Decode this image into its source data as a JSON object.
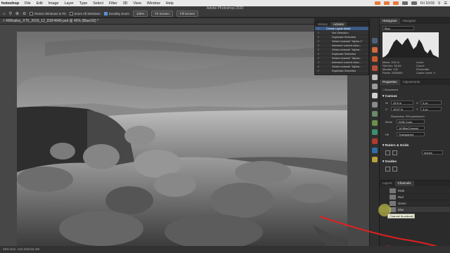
{
  "menubar": {
    "app": "hotoshop",
    "items": [
      "File",
      "Edit",
      "Image",
      "Layer",
      "Type",
      "Select",
      "Filter",
      "3D",
      "View",
      "Window",
      "Help"
    ],
    "clock": "Fri 10:03"
  },
  "window": {
    "title": "Adobe Photoshop 2020"
  },
  "options": {
    "resize_windows": "Resize Windows to Fit",
    "zoom_all": "Zoom All Windows",
    "scrubby_zoom": "Scrubby Zoom",
    "zoom_level": "100%",
    "fit_screen": "Fit Screen",
    "fill_screen": "Fill Screen"
  },
  "document": {
    "tab_title": "RWhalley_XT5_2019_12_DSF4949.psd @ 45% (Blue/16) *"
  },
  "status": {
    "text": "45%   Doc: 144.1M/144.1M"
  },
  "actions_panel": {
    "tabs": [
      "History",
      "Actions"
    ],
    "items": [
      {
        "label": "Create Lights Mask",
        "selected": true
      },
      {
        "label": "Set Selection",
        "selected": false
      },
      {
        "label": "Duplicate Selection",
        "selected": false
      },
      {
        "label": "Select channel \"Alpha 1\"",
        "selected": false
      },
      {
        "label": "Intersect current chan...",
        "selected": false
      },
      {
        "label": "Select channel \"Alpha...",
        "selected": false
      },
      {
        "label": "Duplicate Selection",
        "selected": false
      },
      {
        "label": "Select channel \"Alpha...",
        "selected": false
      },
      {
        "label": "Intersect current chan...",
        "selected": false
      },
      {
        "label": "Select channel \"Alpha...",
        "selected": false
      },
      {
        "label": "Duplicate Selection",
        "selected": false
      }
    ]
  },
  "histogram_panel": {
    "tabs": [
      "Histogram",
      "Navigator"
    ],
    "channel": "Blue",
    "stats_left": [
      "Mean: 109.11",
      "Std Dev: 53.53",
      "Median: 102",
      "Pixels: 1050600"
    ],
    "stats_right": [
      "Level:",
      "Count:",
      "Percentile:",
      "Cache Level: 4"
    ]
  },
  "properties_panel": {
    "tabs": [
      "Properties",
      "Adjustments"
    ],
    "doc_label": "Document",
    "canvas_header": "Canvas",
    "w_label": "W",
    "w_value": "25.8 in",
    "h_label": "H",
    "h_value": "16.67 in",
    "x_label": "X",
    "x_value": "0 px",
    "y_label": "Y",
    "y_value": "0 px",
    "resolution": "Resolution: 300 pixels/inch",
    "mode_label": "Mode",
    "mode_value": "RGB Color",
    "bits_value": "16 Bits/Channel",
    "fill_label": "Fill",
    "fill_value": "Transparent",
    "rulers_header": "Rulers & Grids",
    "units": "Inches",
    "guides_header": "Guides"
  },
  "channels_panel": {
    "tabs": [
      "Layers",
      "Channels"
    ],
    "channels": [
      "RGB",
      "Red",
      "Green",
      "Blue"
    ],
    "tooltip": "Channel thumbnail"
  },
  "colors": {
    "accent_blue": "#3c5a86",
    "annotation_red": "#e02020",
    "highlight_yellow": "#e3e24a"
  }
}
